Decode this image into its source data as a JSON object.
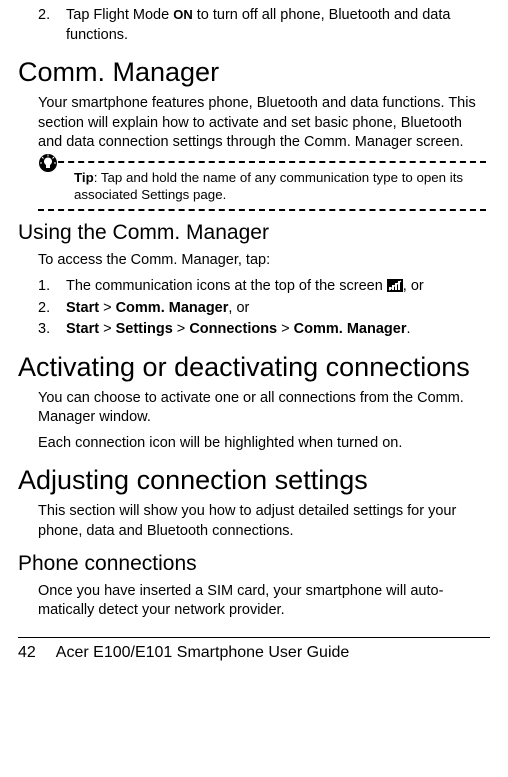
{
  "intro_list": {
    "item2_num": "2.",
    "item2_a": "Tap Flight Mode ",
    "item2_glyph": "ON",
    "item2_b": "  to turn off all phone, Bluetooth and data functions."
  },
  "h1_comm": "Comm. Manager",
  "p_comm": "Your smartphone features phone, Bluetooth and data func­tions. This section will explain how to activate and set basic phone, Bluetooth and data connection settings through the Comm. Manager screen.",
  "tip_label": "Tip",
  "tip_body": ": Tap and hold the name of any communication type to open its associated Settings page.",
  "h2_using": "Using the Comm. Manager",
  "p_access": "To access the Comm. Manager, tap:",
  "list_using": {
    "n1": "1.",
    "i1_a": "The communication icons at the top of the screen ",
    "i1_b": ", or",
    "n2": "2.",
    "i2_start": "Start",
    "i2_gt1": " > ",
    "i2_comm": "Comm. Manager",
    "i2_end": ", or",
    "n3": "3.",
    "i3_start": "Start",
    "i3_gt1": " > ",
    "i3_settings": "Settings",
    "i3_gt2": " > ",
    "i3_conn": "Connections",
    "i3_gt3": " > ",
    "i3_comm": "Comm. Manager",
    "i3_end": "."
  },
  "h1_activating": "Activating or deactivating connections",
  "p_activ1": "You can choose to activate one or all connections from the Comm. Manager window.",
  "p_activ2": "Each connection icon will be highlighted when turned on.",
  "h1_adjust": "Adjusting connection settings",
  "p_adjust": "This section will show you how to adjust detailed settings for your phone, data and Bluetooth connections.",
  "h2_phone": "Phone connections",
  "p_phone": "Once you have inserted a SIM card, your smartphone will auto­matically detect your network provider.",
  "footer": {
    "page": "42",
    "title": "Acer E100/E101 Smartphone User Guide"
  }
}
